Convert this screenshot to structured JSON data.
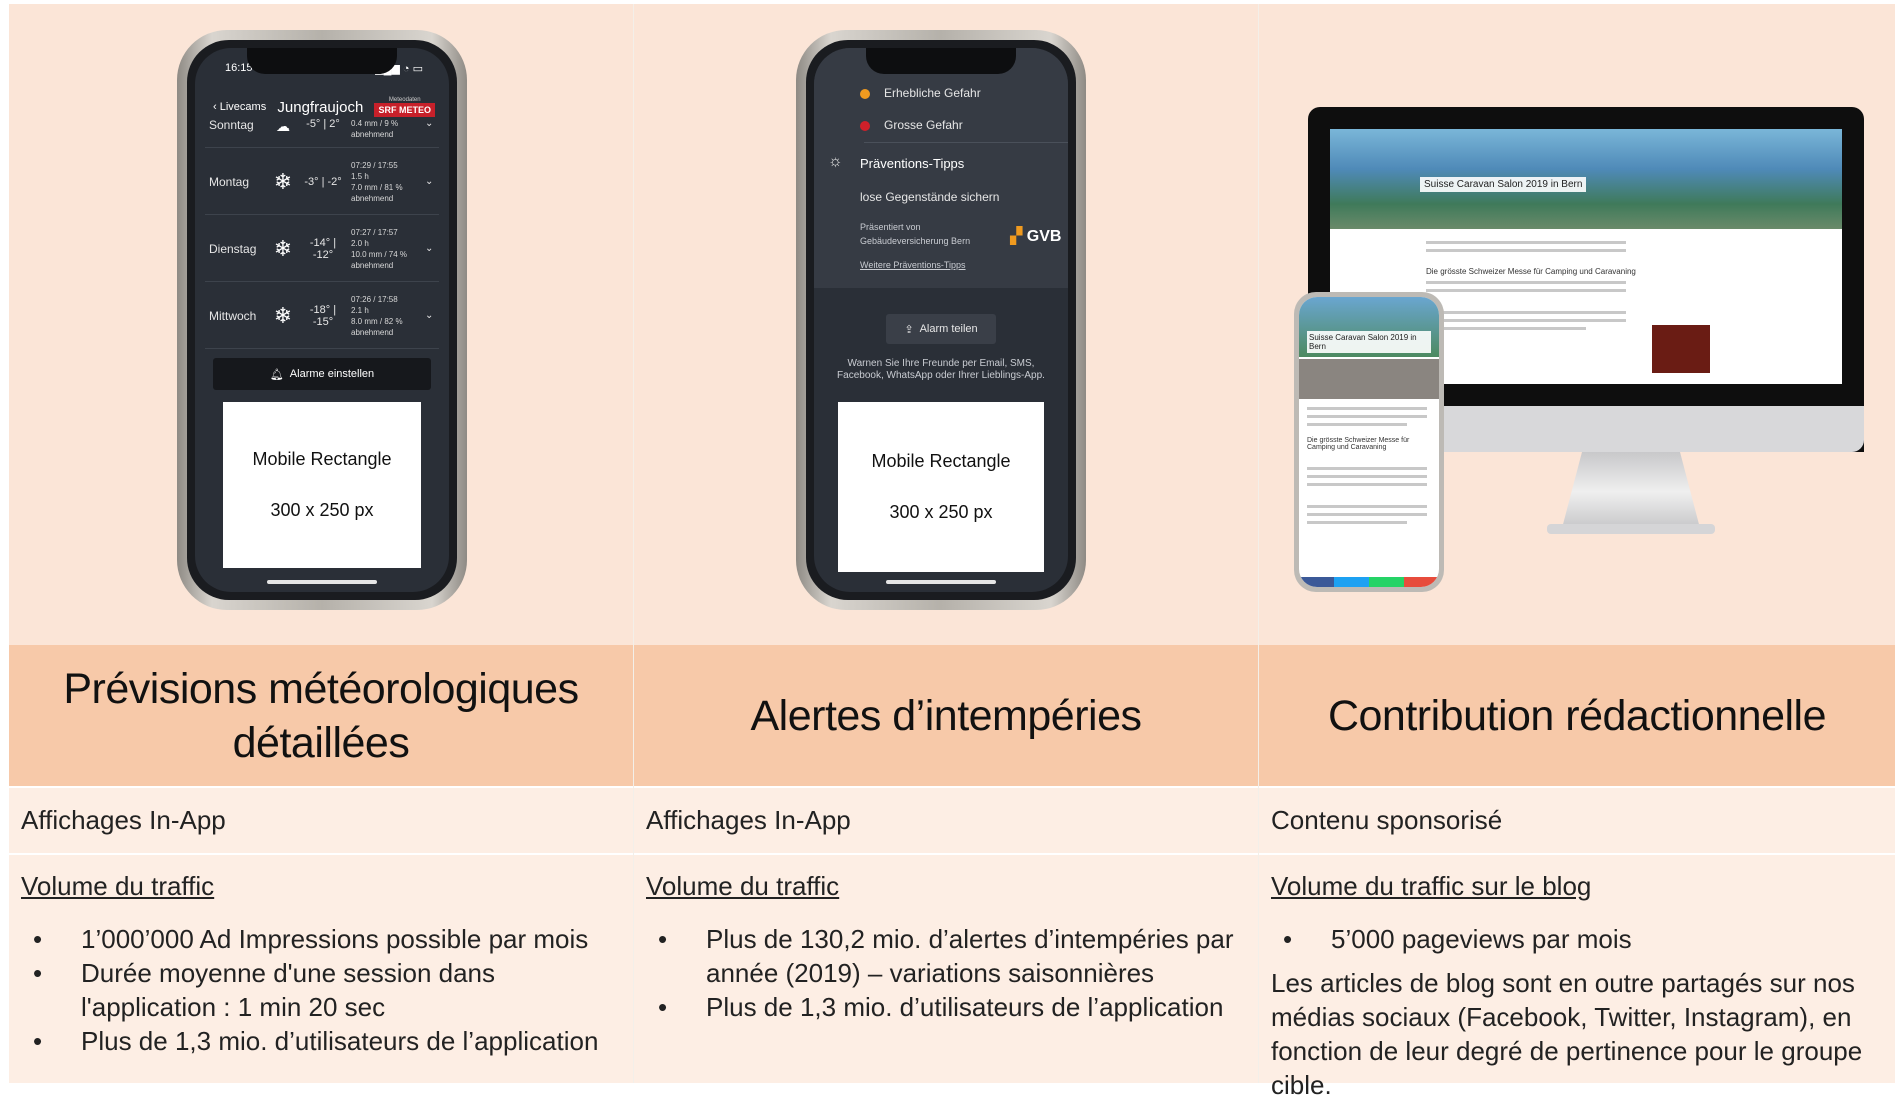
{
  "columns": [
    {
      "heading_line1": "Prévisions météorologiques",
      "heading_line2": "détaillées",
      "subheading": "Affichages In-App",
      "traffic_label": "Volume du traffic",
      "bullets": [
        "1’000’000 Ad Impressions possible par mois",
        "Durée moyenne d'une session dans l'application : 1 min 20 sec",
        "Plus de 1,3 mio. d’utilisateurs de l’application"
      ],
      "phone": {
        "time": "16:15",
        "back": "Livecams",
        "title": "Jungfraujoch",
        "brand_small": "Meteodaten",
        "brand": "SRF METEO",
        "rows": [
          {
            "day": "Sonntag",
            "temp": "-5° | 2°",
            "detail": [
              "0.4 mm / 9 %",
              "abnehmend"
            ]
          },
          {
            "day": "Montag",
            "temp": "-3° | -2°",
            "detail": [
              "07:29 / 17:55",
              "1.5 h",
              "7.0 mm / 81 %",
              "abnehmend"
            ]
          },
          {
            "day": "Dienstag",
            "temp": "-14° | -12°",
            "detail": [
              "07:27 / 17:57",
              "2.0 h",
              "10.0 mm / 74 %",
              "abnehmend"
            ]
          },
          {
            "day": "Mittwoch",
            "temp": "-18° | -15°",
            "detail": [
              "07:26 / 17:58",
              "2.1 h",
              "8.0 mm / 82 %",
              "abnehmend"
            ]
          }
        ],
        "alarm_button": "Alarme einstellen",
        "ad_line1": "Mobile Rectangle",
        "ad_line2": "300 x 250 px"
      }
    },
    {
      "heading_line1": "Alertes d’intempéries",
      "subheading": "Affichages In-App",
      "traffic_label": "Volume du traffic",
      "bullets": [
        "Plus de 130,2 mio. d’alertes d’intempéries par année (2019) – variations saisonnières",
        "Plus de 1,3 mio. d’utilisateurs de l’application"
      ],
      "phone": {
        "level1": "Erhebliche Gefahr",
        "level2": "Grosse Gefahr",
        "tips_title": "Präventions-Tipps",
        "tip": "lose Gegenstände sichern",
        "presented": "Präsentiert von Gebäudeversicherung Bern",
        "brand": "GVB",
        "more_tips": "Weitere Präventions-Tipps",
        "share_button": "Alarm teilen",
        "share_note": "Warnen Sie Ihre Freunde per Email, SMS, Facebook, WhatsApp oder Ihrer Lieblings-App.",
        "ad_line1": "Mobile Rectangle",
        "ad_line2": "300 x 250 px"
      }
    },
    {
      "heading_line1": "Contribution rédactionnelle",
      "subheading": "Contenu sponsorisé",
      "traffic_label": "Volume du traffic sur le blog",
      "bullets": [
        "5’000 pageviews par mois"
      ],
      "paragraph": "Les articles de blog sont en outre partagés sur nos médias sociaux (Facebook, Twitter, Instagram), en fonction de leur degré de pertinence pour le groupe cible.",
      "desktop": {
        "banner_title": "Suisse Caravan Salon 2019 in Bern",
        "article_title": "Die grösste Schweizer Messe für Camping und Caravaning",
        "mobile_title": "Suisse Caravan Salon 2019 in Bern",
        "mobile_heading": "Die grösste Schweizer Messe für Camping und Caravaning"
      }
    }
  ],
  "colors": {
    "image_bg": "#fbe5d7",
    "heading_bg": "#f7c9a9",
    "body_bg": "#fdeee4",
    "orange_dot": "#f09a1f",
    "red_dot": "#d0202a"
  }
}
